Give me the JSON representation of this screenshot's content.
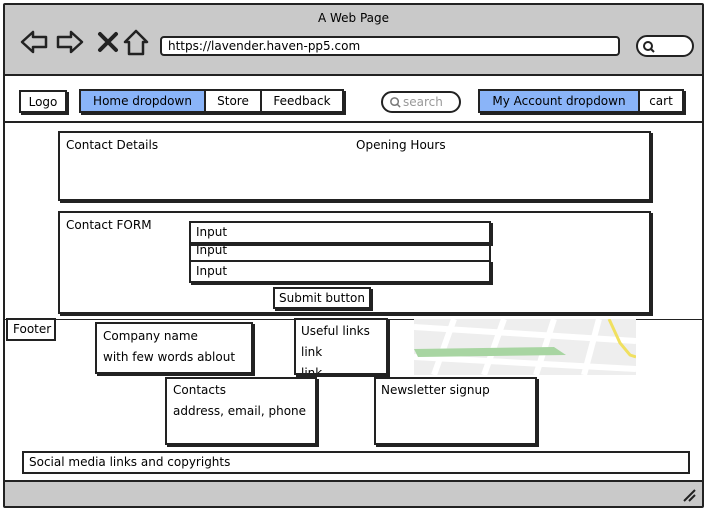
{
  "window": {
    "title": "A Web Page"
  },
  "browser": {
    "url": "https://lavender.haven-pp5.com",
    "icons": [
      "back-arrow-icon",
      "forward-arrow-icon",
      "close-x-icon",
      "home-icon",
      "search-icon"
    ]
  },
  "navbar": {
    "logo": "Logo",
    "home": "Home dropdown",
    "store": "Store",
    "feedback": "Feedback",
    "search_placeholder": "search",
    "account": "My Account dropdown",
    "cart": "cart",
    "accent_color": "#8ab4f8"
  },
  "contact_details": {
    "title": "Contact Details",
    "hours": "Opening Hours"
  },
  "contact_form": {
    "title": "Contact FORM",
    "inputs": [
      "Input",
      "Input",
      "Input"
    ],
    "submit": "Submit button"
  },
  "footer": {
    "label": "Footer",
    "company_name": "Company name",
    "company_desc": "with few words ablout",
    "useful_links_title": "Useful links",
    "links": [
      "link",
      "link"
    ],
    "contacts_title": "Contacts",
    "contacts_detail": "address, email, phone",
    "newsletter": "Newsletter signup",
    "social": "Social media links and copyrights"
  }
}
